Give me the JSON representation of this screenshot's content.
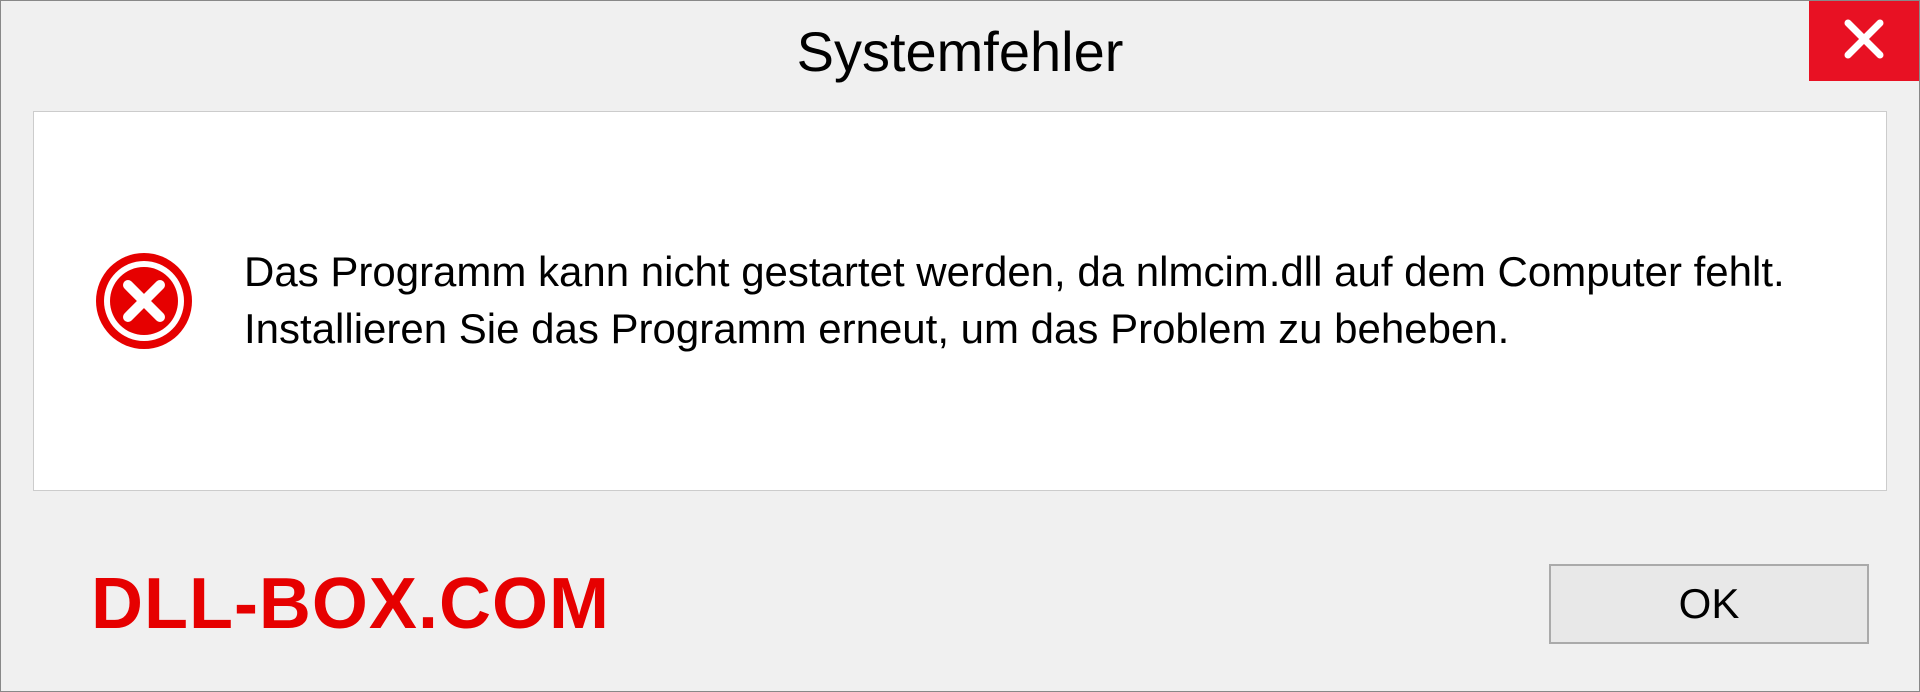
{
  "dialog": {
    "title": "Systemfehler",
    "message": "Das Programm kann nicht gestartet werden, da nlmcim.dll auf dem Computer fehlt. Installieren Sie das Programm erneut, um das Problem zu beheben.",
    "ok_label": "OK"
  },
  "watermark": "DLL-BOX.COM"
}
